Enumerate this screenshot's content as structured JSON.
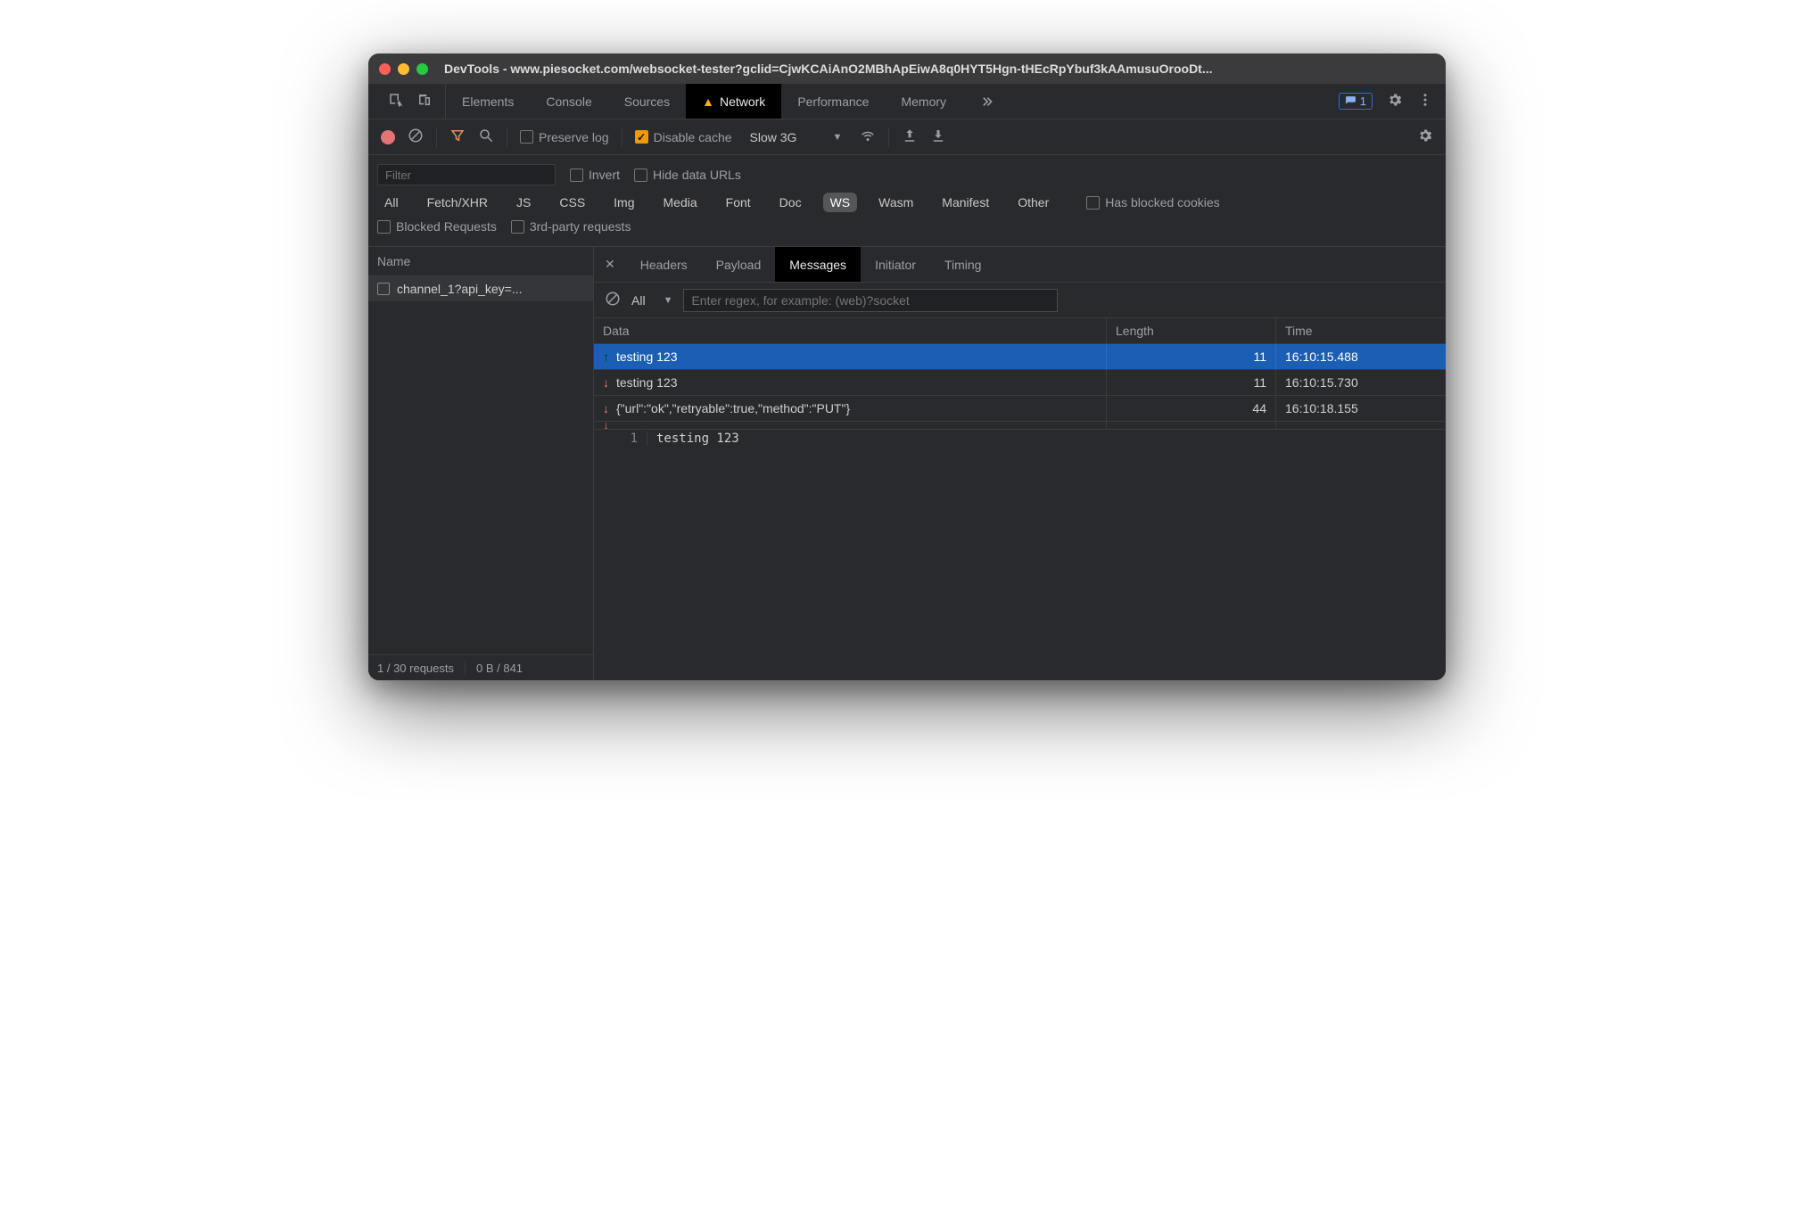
{
  "window": {
    "title": "DevTools - www.piesocket.com/websocket-tester?gclid=CjwKCAiAnO2MBhApEiwA8q0HYT5Hgn-tHEcRpYbuf3kAAmusuOrooDt..."
  },
  "maintabs": {
    "items": [
      "Elements",
      "Console",
      "Sources",
      "Network",
      "Performance",
      "Memory"
    ],
    "active": "Network",
    "issues_count": "1"
  },
  "toolbar": {
    "preserve_log": "Preserve log",
    "disable_cache": "Disable cache",
    "throttling": "Slow 3G"
  },
  "filter": {
    "placeholder": "Filter",
    "invert": "Invert",
    "hide_data_urls": "Hide data URLs",
    "types": [
      "All",
      "Fetch/XHR",
      "JS",
      "CSS",
      "Img",
      "Media",
      "Font",
      "Doc",
      "WS",
      "Wasm",
      "Manifest",
      "Other"
    ],
    "selected_type": "WS",
    "has_blocked_cookies": "Has blocked cookies",
    "blocked_requests": "Blocked Requests",
    "third_party": "3rd-party requests"
  },
  "sidebar": {
    "header": "Name",
    "requests": [
      {
        "name": "channel_1?api_key=..."
      }
    ],
    "status": {
      "requests": "1 / 30 requests",
      "transfer": "0 B / 841"
    }
  },
  "detail": {
    "tabs": [
      "Headers",
      "Payload",
      "Messages",
      "Initiator",
      "Timing"
    ],
    "active": "Messages",
    "filter_dropdown": "All",
    "filter_placeholder": "Enter regex, for example: (web)?socket",
    "columns": {
      "data": "Data",
      "length": "Length",
      "time": "Time"
    },
    "messages": [
      {
        "dir": "up",
        "data": "testing 123",
        "length": "11",
        "time": "16:10:15.488",
        "selected": true
      },
      {
        "dir": "down",
        "data": "testing 123",
        "length": "11",
        "time": "16:10:15.730"
      },
      {
        "dir": "down",
        "data": "{\"url\":\"ok\",\"retryable\":true,\"method\":\"PUT\"}",
        "length": "44",
        "time": "16:10:18.155"
      }
    ],
    "preview": {
      "line_no": "1",
      "content": "testing 123"
    }
  }
}
